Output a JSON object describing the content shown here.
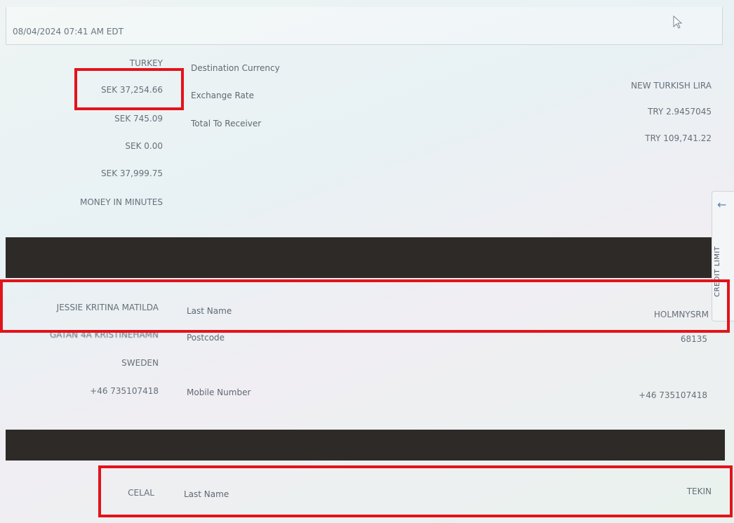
{
  "header": {
    "timestamp": "08/04/2024 07:41 AM EDT"
  },
  "transaction": {
    "left_values": [
      "TURKEY",
      "SEK 37,254.66",
      "SEK 745.09",
      "SEK 0.00",
      "SEK 37,999.75",
      "MONEY IN MINUTES"
    ],
    "labels": [
      "Destination Currency",
      "Exchange Rate",
      "Total To Receiver"
    ],
    "right_values": [
      "NEW TURKISH LIRA",
      "TRY 2.9457045",
      "TRY 109,741.22"
    ]
  },
  "sender": {
    "first_name": "JESSIE KRITINA MATILDA",
    "last_name_label": "Last Name",
    "last_name": "HOLMNYSRM",
    "address": "GATAN 4A KRISTINEHAMN",
    "postcode_label": "Postcode",
    "postcode": "68135",
    "country": "SWEDEN",
    "phone": "+46 735107418",
    "mobile_label": "Mobile Number",
    "mobile": "+46 735107418"
  },
  "receiver": {
    "first_name": "CELAL",
    "last_name_label": "Last Name",
    "last_name": "TEKIN"
  },
  "side_tab": {
    "label": "CREDIT LIMIT",
    "arrow": "←"
  },
  "colors": {
    "highlight": "#e3131b",
    "band": "#2e2a27"
  }
}
